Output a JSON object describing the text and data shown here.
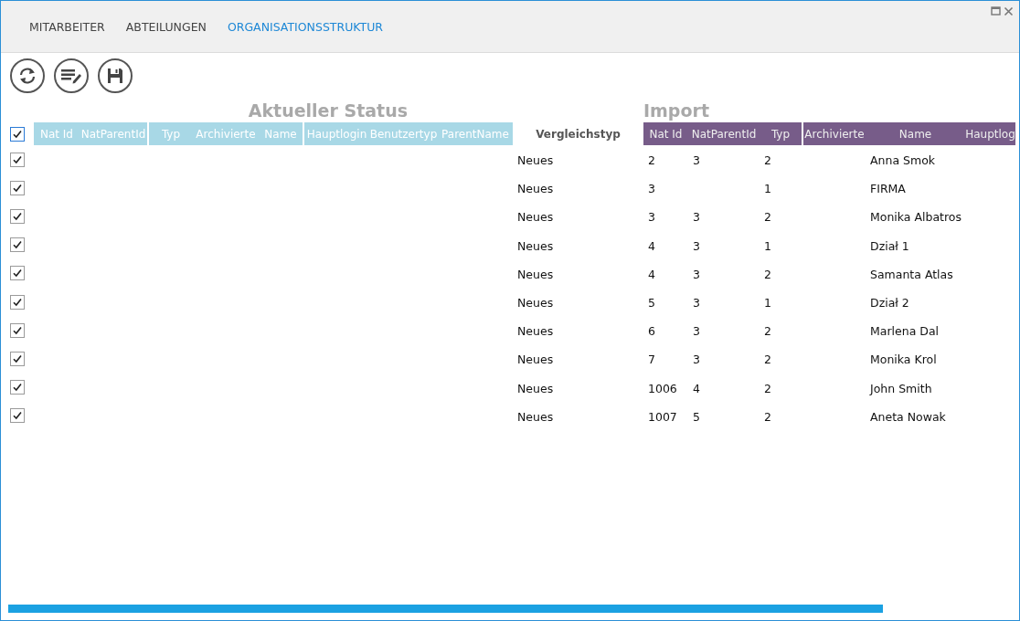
{
  "tabs": [
    {
      "label": "MITARBEITER",
      "selected": false
    },
    {
      "label": "ABTEILUNGEN",
      "selected": false
    },
    {
      "label": "ORGANISATIONSSTRUKTUR",
      "selected": true
    }
  ],
  "current_title": "Aktueller Status",
  "import_title": "Import",
  "select_all": {
    "checked": true
  },
  "current_columns": [
    [
      "Nat Id",
      "NatParentId"
    ],
    [
      "Typ",
      "Archivierte",
      "Name"
    ],
    [
      "Hauptlogin",
      "Benutzertyp",
      "ParentName"
    ]
  ],
  "comparison_column": "Vergleichstyp",
  "import_columns": [
    [
      "Nat Id",
      "NatParentId",
      "Typ"
    ],
    [
      "Archivierte",
      "Name",
      "Hauptlog"
    ]
  ],
  "rows": [
    {
      "checked": true,
      "vergleichstyp": "Neues",
      "nat_id": "2",
      "nat_parent_id": "3",
      "typ": "2",
      "name": "Anna Smok"
    },
    {
      "checked": true,
      "vergleichstyp": "Neues",
      "nat_id": "3",
      "typ": "1",
      "name": "FIRMA"
    },
    {
      "checked": true,
      "vergleichstyp": "Neues",
      "nat_id": "3",
      "nat_parent_id": "3",
      "typ": "2",
      "name": "Monika Albatros"
    },
    {
      "checked": true,
      "vergleichstyp": "Neues",
      "nat_id": "4",
      "nat_parent_id": "3",
      "typ": "1",
      "name": "Dział 1"
    },
    {
      "checked": true,
      "vergleichstyp": "Neues",
      "nat_id": "4",
      "nat_parent_id": "3",
      "typ": "2",
      "name": "Samanta Atlas"
    },
    {
      "checked": true,
      "vergleichstyp": "Neues",
      "nat_id": "5",
      "nat_parent_id": "3",
      "typ": "1",
      "name": "Dział 2"
    },
    {
      "checked": true,
      "vergleichstyp": "Neues",
      "nat_id": "6",
      "nat_parent_id": "3",
      "typ": "2",
      "name": "Marlena Dal"
    },
    {
      "checked": true,
      "vergleichstyp": "Neues",
      "nat_id": "7",
      "nat_parent_id": "3",
      "typ": "2",
      "name": "Monika Krol"
    },
    {
      "checked": true,
      "vergleichstyp": "Neues",
      "nat_id": "1006",
      "nat_parent_id": "4",
      "typ": "2",
      "name": "John Smith"
    },
    {
      "checked": true,
      "vergleichstyp": "Neues",
      "nat_id": "1007",
      "nat_parent_id": "5",
      "typ": "2",
      "name": "Aneta Nowak"
    }
  ]
}
